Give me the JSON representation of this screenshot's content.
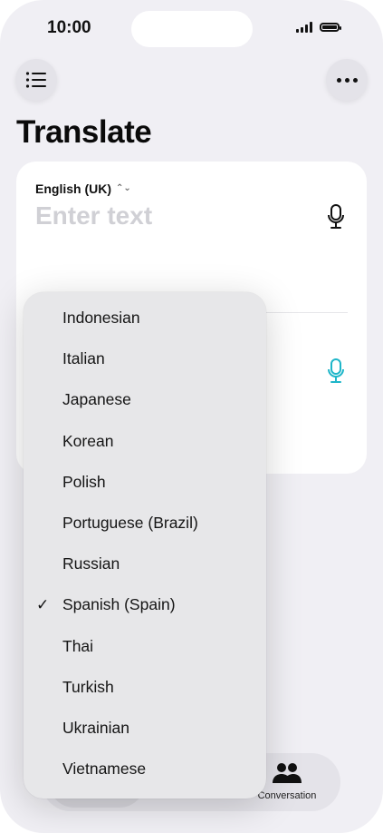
{
  "status_bar": {
    "time": "10:00"
  },
  "header": {
    "title": "Translate"
  },
  "translator": {
    "source_language": "English (UK)",
    "input_placeholder": "Enter text"
  },
  "tabbar": {
    "conversation_label": "Conversation"
  },
  "language_menu": {
    "selected": "Spanish (Spain)",
    "items": [
      "Indonesian",
      "Italian",
      "Japanese",
      "Korean",
      "Polish",
      "Portuguese (Brazil)",
      "Russian",
      "Spanish (Spain)",
      "Thai",
      "Turkish",
      "Ukrainian",
      "Vietnamese"
    ]
  },
  "colors": {
    "background": "#f0eff4",
    "card": "#ffffff",
    "menu": "#e7e7e9",
    "accent_mic": "#1fb6c9"
  },
  "icons": {
    "menu": "list-icon",
    "more": "ellipsis-icon",
    "mic": "microphone-icon",
    "conversation": "people-icon"
  }
}
